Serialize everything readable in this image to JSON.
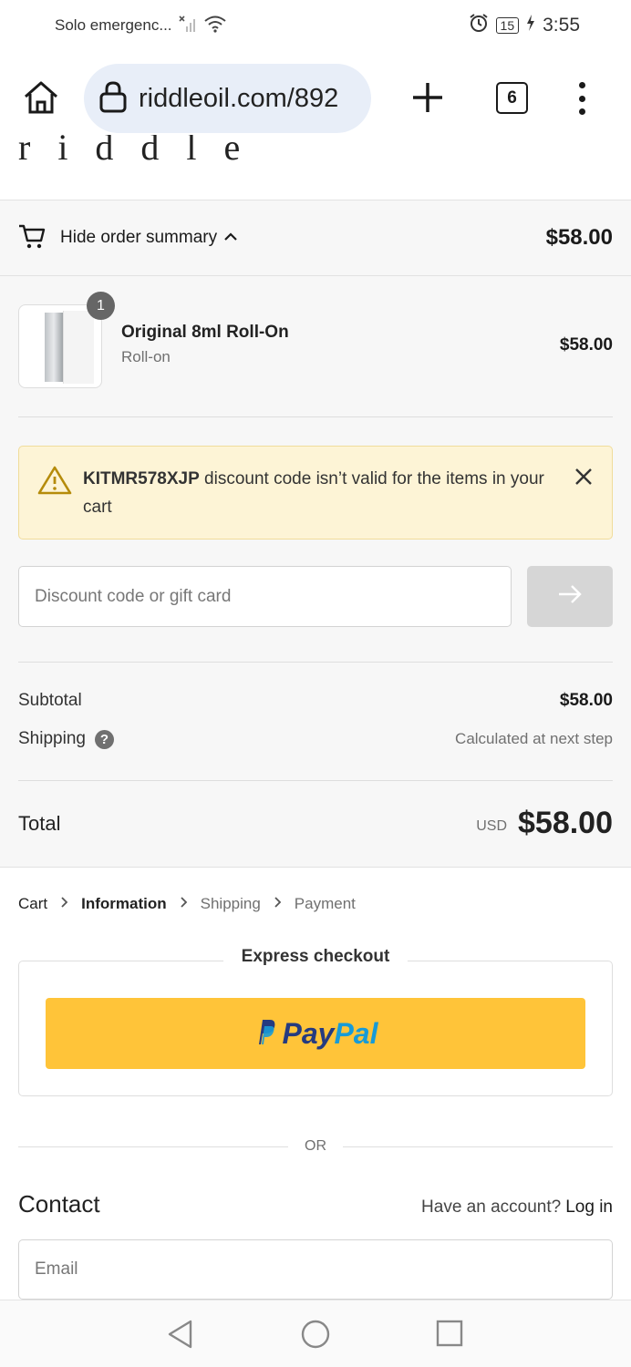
{
  "status": {
    "carrier": "Solo emergenc...",
    "battery": "15",
    "time": "3:55"
  },
  "browser": {
    "url": "riddleoil.com/892",
    "tab_count": "6"
  },
  "brand": {
    "logo_text": "riddle"
  },
  "summary": {
    "toggle_label": "Hide order summary",
    "header_total": "$58.00"
  },
  "product": {
    "quantity": "1",
    "name": "Original 8ml Roll-On",
    "variant": "Roll-on",
    "price": "$58.00"
  },
  "alert": {
    "code": "KITMR578XJP",
    "message": " discount code isn’t valid for the items in your cart"
  },
  "discount": {
    "placeholder": "Discount code or gift card"
  },
  "totals": {
    "subtotal_label": "Subtotal",
    "subtotal_value": "$58.00",
    "shipping_label": "Shipping",
    "shipping_value": "Calculated at next step",
    "total_label": "Total",
    "currency": "USD",
    "total_value": "$58.00"
  },
  "breadcrumb": {
    "items": [
      "Cart",
      "Information",
      "Shipping",
      "Payment"
    ]
  },
  "express": {
    "title": "Express checkout",
    "paypal_pay": "Pay",
    "paypal_pal": "Pal"
  },
  "divider_text": "OR",
  "contact": {
    "heading": "Contact",
    "account_prompt": "Have an account?",
    "login_label": "Log in",
    "email_placeholder": "Email"
  },
  "colors": {
    "alert_bg": "#fdf4d6",
    "paypal_yellow": "#ffc439",
    "paypal_dark": "#253b80",
    "paypal_light": "#179bd7"
  }
}
